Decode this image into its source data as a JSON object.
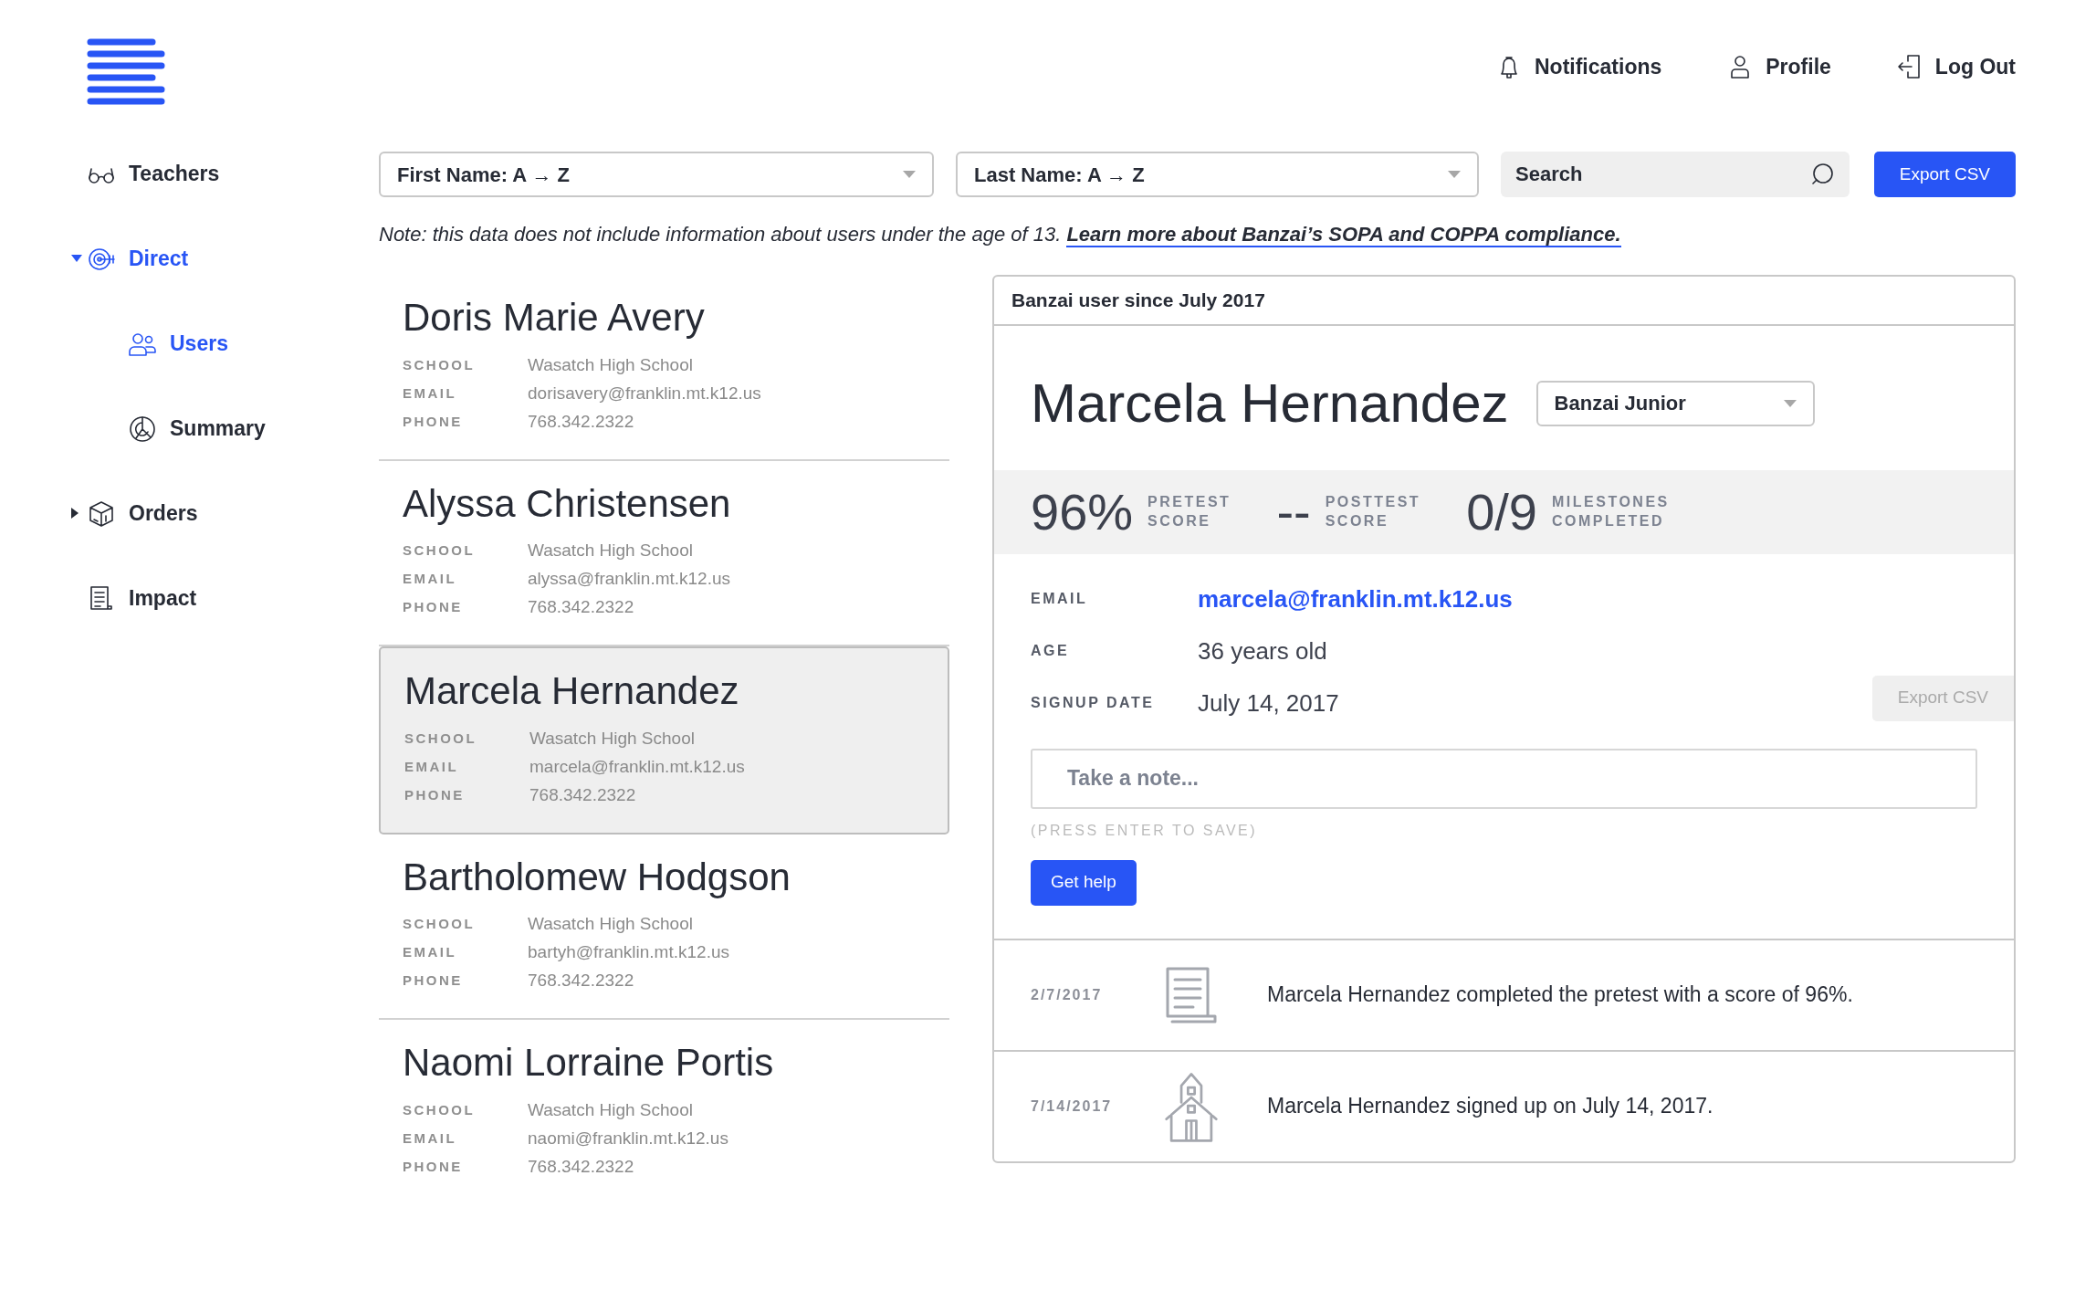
{
  "top_nav": [
    {
      "label": "Notifications"
    },
    {
      "label": "Profile"
    },
    {
      "label": "Log Out"
    }
  ],
  "sidebar": {
    "items": [
      {
        "label": "Teachers",
        "selected": false
      },
      {
        "label": "Direct",
        "selected": true,
        "expanded": true,
        "children": [
          {
            "label": "Users",
            "selected": true
          },
          {
            "label": "Summary",
            "selected": false
          }
        ]
      },
      {
        "label": "Orders",
        "selected": false,
        "expanded": false
      },
      {
        "label": "Impact",
        "selected": false
      }
    ]
  },
  "filters": {
    "sorts": [
      {
        "value": "First Name: A → Z"
      },
      {
        "value": "Last Name: A → Z"
      }
    ],
    "search": {
      "placeholder": "Search"
    },
    "export_button": {
      "label": "Export CSV",
      "disabled": false
    }
  },
  "note": {
    "text": "Note: this data does not include information about users under the age of 13.",
    "link": "Learn more about Banzai’s SOPA and COPPA compliance."
  },
  "users": [
    {
      "name": "Doris Marie Avery",
      "selected": false,
      "fields": [
        {
          "label": "SCHOOL",
          "value": "Wasatch High School"
        },
        {
          "label": "EMAIL",
          "value": "dorisavery@franklin.mt.k12.us"
        },
        {
          "label": "PHONE",
          "value": "768.342.2322"
        }
      ]
    },
    {
      "name": "Alyssa Christensen",
      "selected": false,
      "fields": [
        {
          "label": "SCHOOL",
          "value": "Wasatch High School"
        },
        {
          "label": "EMAIL",
          "value": "alyssa@franklin.mt.k12.us"
        },
        {
          "label": "PHONE",
          "value": "768.342.2322"
        }
      ]
    },
    {
      "name": "Marcela Hernandez",
      "selected": true,
      "fields": [
        {
          "label": "SCHOOL",
          "value": "Wasatch High School"
        },
        {
          "label": "EMAIL",
          "value": "marcela@franklin.mt.k12.us"
        },
        {
          "label": "PHONE",
          "value": "768.342.2322"
        }
      ]
    },
    {
      "name": "Bartholomew Hodgson",
      "selected": false,
      "fields": [
        {
          "label": "SCHOOL",
          "value": "Wasatch High School"
        },
        {
          "label": "EMAIL",
          "value": "bartyh@franklin.mt.k12.us"
        },
        {
          "label": "PHONE",
          "value": "768.342.2322"
        }
      ]
    },
    {
      "name": "Naomi Lorraine Portis",
      "selected": false,
      "fields": [
        {
          "label": "SCHOOL",
          "value": "Wasatch High School"
        },
        {
          "label": "EMAIL",
          "value": "naomi@franklin.mt.k12.us"
        },
        {
          "label": "PHONE",
          "value": "768.342.2322"
        }
      ]
    }
  ],
  "detail": {
    "header": "Banzai user since July 2017",
    "name": "Marcela Hernandez",
    "plan": "Banzai Junior",
    "stats": [
      {
        "value": "96%",
        "label": "PRETEST SCORE"
      },
      {
        "value": "--",
        "label": "POSTTEST SCORE"
      },
      {
        "value": "0/9",
        "label": "MILESTONES COMPLETED"
      }
    ],
    "fields": [
      {
        "label": "EMAIL",
        "value": "marcela@franklin.mt.k12.us",
        "kind": "link"
      },
      {
        "label": "AGE",
        "value": "36 years old",
        "kind": "text"
      },
      {
        "label": "SIGNUP DATE",
        "value": "July 14, 2017",
        "kind": "text"
      }
    ],
    "export_button": {
      "label": "Export CSV",
      "disabled": true
    },
    "note_field": {
      "placeholder": "Take a note..."
    },
    "note_hint": "(PRESS ENTER TO SAVE)",
    "help_button": "Get help",
    "timeline": [
      {
        "date": "2/7/2017",
        "text": "Marcela Hernandez completed the pretest with a score of 96%."
      },
      {
        "date": "7/14/2017",
        "text": "Marcela Hernandez signed up on July 14, 2017."
      }
    ]
  }
}
